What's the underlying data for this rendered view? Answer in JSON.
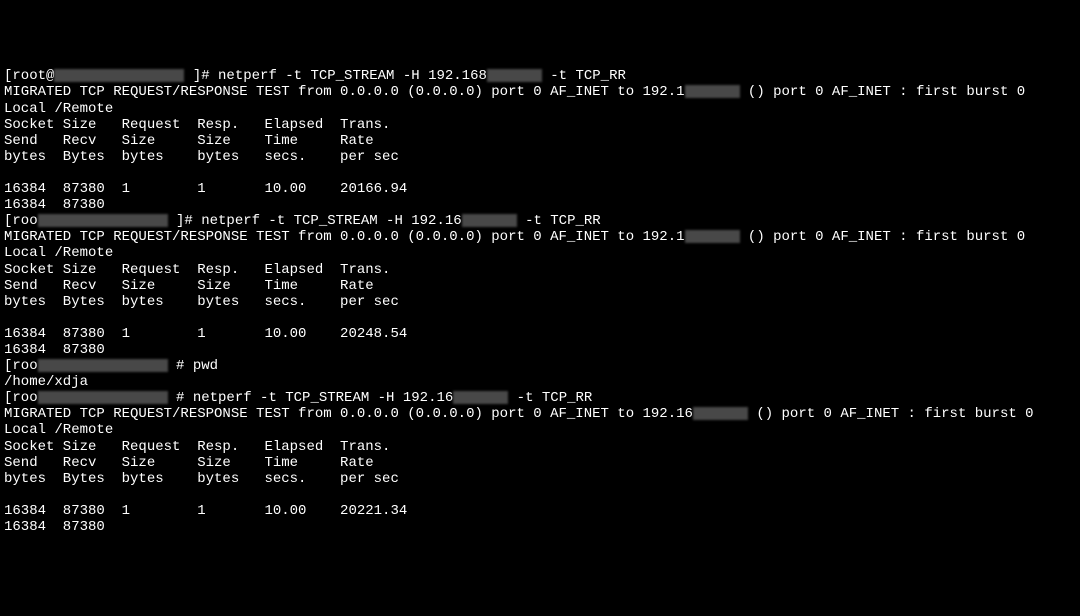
{
  "prompt_prefix_1": "[root@",
  "prompt_prefix_2": "[roo",
  "prompt_suffix_1": " ]# ",
  "prompt_suffix_2": " # ",
  "cmd_netperf_1": "netperf -t TCP_STREAM -H 192.168",
  "cmd_netperf_2": "netperf -t TCP_STREAM -H 192.16",
  "cmd_netperf_tail": " -t TCP_RR",
  "cmd_pwd": "pwd",
  "pwd_out": "/home/xdja",
  "migrated_pre_1": "MIGRATED TCP REQUEST/RESPONSE TEST from 0.0.0.0 (0.0.0.0) port 0 AF_INET to 192.1",
  "migrated_pre_2": "MIGRATED TCP REQUEST/RESPONSE TEST from 0.0.0.0 (0.0.0.0) port 0 AF_INET to 192.16",
  "migrated_post": " () port 0 AF_INET : first burst 0",
  "local_remote": "Local /Remote",
  "hdr1": "Socket Size   Request  Resp.   Elapsed  Trans.",
  "hdr2": "Send   Recv   Size     Size    Time     Rate         ",
  "hdr3": "bytes  Bytes  bytes    bytes   secs.    per sec   ",
  "results": [
    {
      "row1": "16384  87380  1        1       10.00    20166.94   ",
      "row2": "16384  87380 "
    },
    {
      "row1": "16384  87380  1        1       10.00    20248.54   ",
      "row2": "16384  87380 "
    },
    {
      "row1": "16384  87380  1        1       10.00    20221.34   ",
      "row2": "16384  87380 "
    }
  ]
}
